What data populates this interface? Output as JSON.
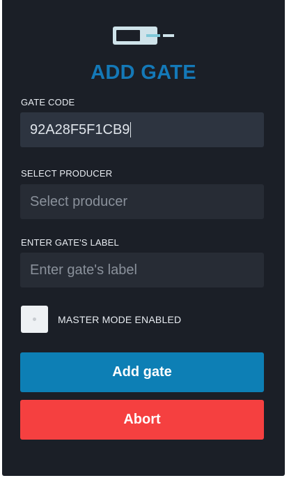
{
  "header": {
    "logo_icon": "gate-logo-icon",
    "title": "ADD GATE"
  },
  "form": {
    "gate_code": {
      "label": "GATE CODE",
      "value": "92A28F5F1CB9"
    },
    "producer": {
      "label": "SELECT PRODUCER",
      "placeholder": "Select producer",
      "value": ""
    },
    "gate_label": {
      "label": "ENTER GATE'S LABEL",
      "placeholder": "Enter gate's label",
      "value": ""
    },
    "master_mode": {
      "label": "MASTER MODE ENABLED",
      "checked": false
    }
  },
  "actions": {
    "add_label": "Add gate",
    "abort_label": "Abort"
  },
  "colors": {
    "background": "#1b1f27",
    "title_accent": "#1479b8",
    "add_button": "#0d7fb5",
    "abort_button": "#f54040",
    "field_bg": "#2b313b"
  }
}
